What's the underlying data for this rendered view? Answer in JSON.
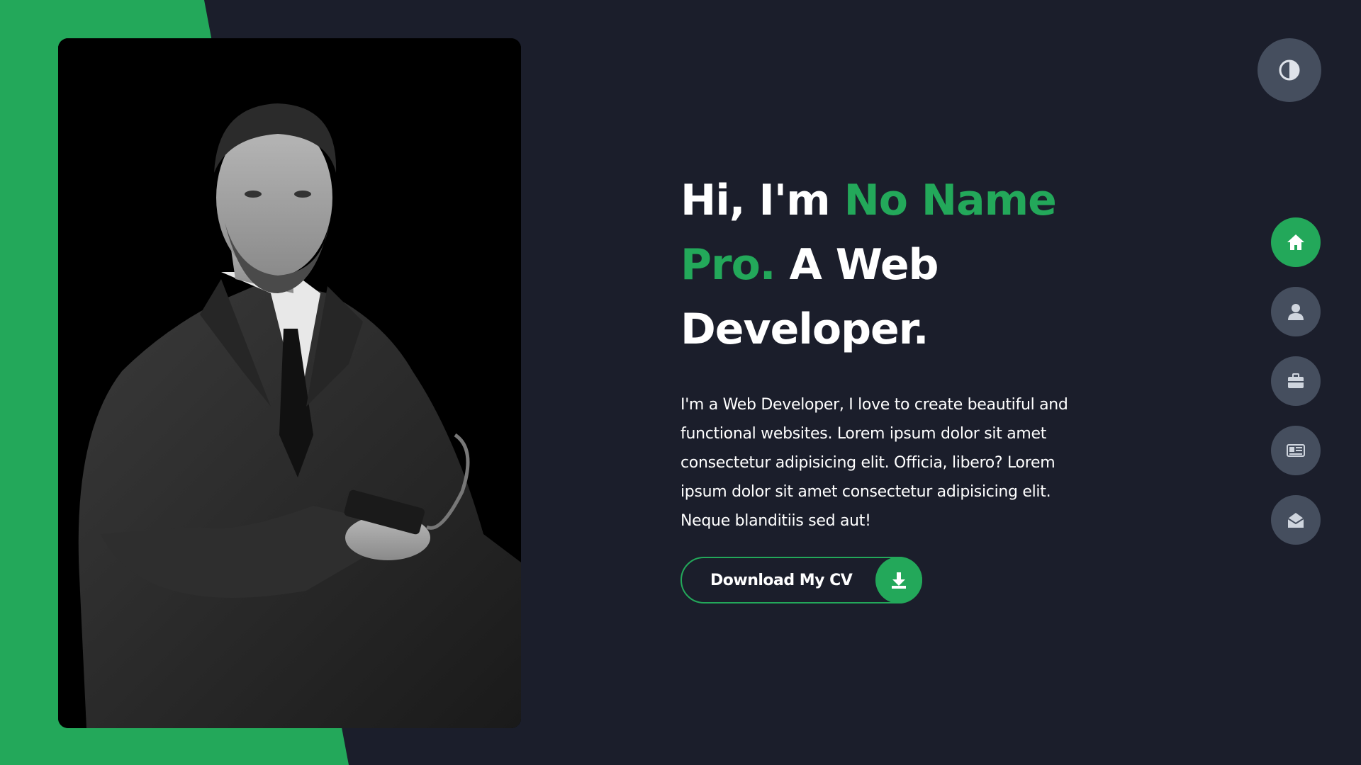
{
  "colors": {
    "accent": "#23a85a",
    "background": "#1b1e2b",
    "nav_button": "#454e5e",
    "text": "#ffffff"
  },
  "hero": {
    "title_line_prefix": "Hi, I'm ",
    "title_name_part1": "No Name",
    "title_name_part2": "Pro.",
    "title_suffix_1": " A Web",
    "title_suffix_2": "Developer.",
    "description": "I'm a Web Developer, I love to create beautiful and functional websites. Lorem ipsum dolor sit amet consectetur adipisicing elit. Officia, libero? Lorem ipsum dolor sit amet consectetur adipisicing elit. Neque blanditiis sed aut!",
    "cv_button_label": "Download My CV",
    "cv_button_icon": "download-icon"
  },
  "theme_toggle": {
    "icon": "half-circle-contrast-icon"
  },
  "side_nav": {
    "items": [
      {
        "icon": "home-icon",
        "active": true
      },
      {
        "icon": "user-icon",
        "active": false
      },
      {
        "icon": "briefcase-icon",
        "active": false
      },
      {
        "icon": "newspaper-icon",
        "active": false
      },
      {
        "icon": "envelope-open-icon",
        "active": false
      }
    ]
  },
  "photo": {
    "icon": "portrait-photo"
  }
}
